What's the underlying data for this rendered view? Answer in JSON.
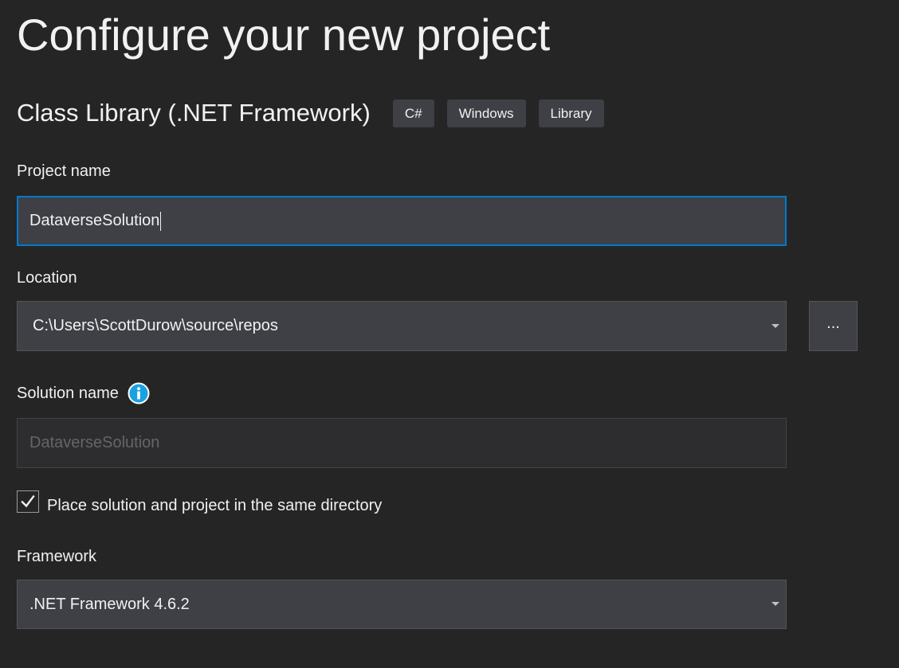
{
  "page": {
    "title": "Configure your new project"
  },
  "template": {
    "name": "Class Library (.NET Framework)",
    "tags": [
      "C#",
      "Windows",
      "Library"
    ]
  },
  "project_name": {
    "label": "Project name",
    "value": "DataverseSolution"
  },
  "location": {
    "label": "Location",
    "value": "C:\\Users\\ScottDurow\\source\\repos",
    "browse_label": "..."
  },
  "solution_name": {
    "label": "Solution name",
    "placeholder": "DataverseSolution",
    "info_icon": "info-icon"
  },
  "same_directory": {
    "label": "Place solution and project in the same directory",
    "checked": true
  },
  "framework": {
    "label": "Framework",
    "selected": ".NET Framework 4.6.2"
  },
  "colors": {
    "background": "#252526",
    "input_background": "#3f3f46",
    "focus_border": "#007acc",
    "info_icon": "#1ba1e2",
    "text": "#f1f1f1"
  }
}
